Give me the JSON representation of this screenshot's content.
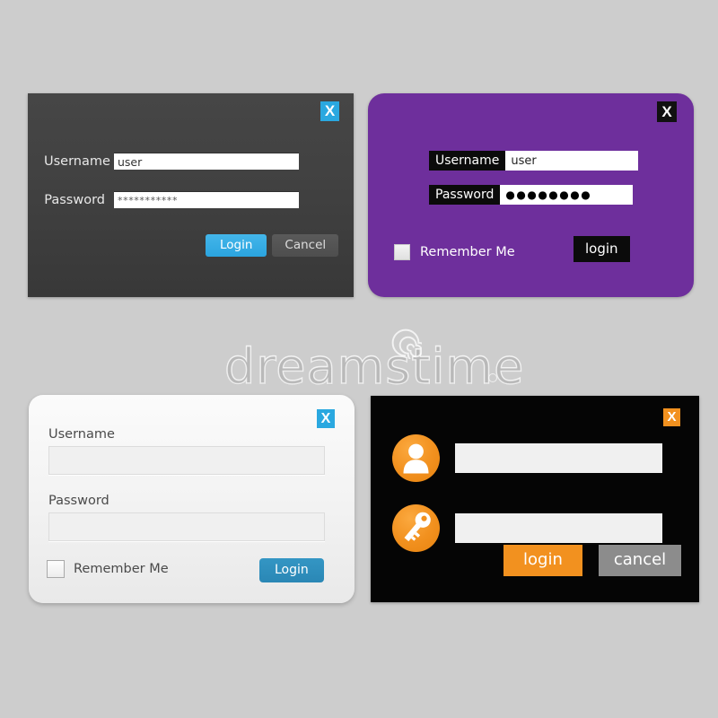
{
  "background_color": "#cdcdcd",
  "watermark": {
    "text": "dreamstime",
    "logo_icon": "spiral-icon",
    "dot_icon": "registered-dot-icon"
  },
  "panels": {
    "dark": {
      "name": "Dark Login Form",
      "background_color": "#414141",
      "close_label": "X",
      "close_color": "#2aa8e0",
      "username_label": "Username",
      "username_value": "user",
      "password_label": "Password",
      "password_value": "***********",
      "login_label": "Login",
      "login_color": "#2ba4df",
      "cancel_label": "Cancel",
      "cancel_color": "#4e4e4e"
    },
    "purple": {
      "name": "Purple Login Form",
      "background_color": "#6e2f9c",
      "close_label": "X",
      "close_color": "#0b0b0b",
      "username_label": "Username",
      "username_value": "user",
      "password_label": "Password",
      "password_value": "●●●●●●●●",
      "remember_label": "Remember Me",
      "remember_checked": false,
      "login_label": "login",
      "login_color": "#0b0b0b"
    },
    "light": {
      "name": "Light Login Form",
      "background_color": "#f2f2f2",
      "close_label": "X",
      "close_color": "#2aa8e0",
      "username_label": "Username",
      "username_value": "",
      "username_placeholder": "",
      "password_label": "Password",
      "password_value": "",
      "password_placeholder": "",
      "remember_label": "Remember Me",
      "remember_checked": false,
      "login_label": "Login",
      "login_color": "#2a87b5"
    },
    "black": {
      "name": "Black Login Form",
      "background_color": "#050505",
      "close_label": "X",
      "close_color": "#f2911f",
      "username_icon": "user-avatar-icon",
      "username_value": "",
      "username_placeholder": "",
      "password_icon": "key-icon",
      "password_value": "",
      "password_placeholder": "",
      "login_label": "login",
      "login_color": "#f2911f",
      "cancel_label": "cancel",
      "cancel_color": "#8c8c8c"
    }
  }
}
